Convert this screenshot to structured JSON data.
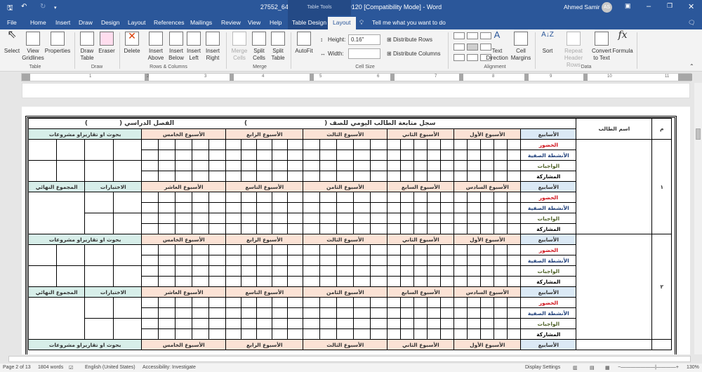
{
  "window": {
    "title": "27552_64ff1ab885a79_1694440120 [Compatibility Mode]  -  Word",
    "context_tab_group": "Table Tools",
    "user": "Ahmed Samir",
    "avatar_initials": "AS"
  },
  "tabs": [
    "File",
    "Home",
    "Insert",
    "Draw",
    "Design",
    "Layout",
    "References",
    "Mailings",
    "Review",
    "View",
    "Help",
    "Table Design",
    "Layout"
  ],
  "tell_me": "Tell me what you want to do",
  "ribbon": {
    "table": {
      "label": "Table",
      "select": "Select",
      "view_gridlines": "View Gridlines",
      "properties": "Properties"
    },
    "draw": {
      "label": "Draw",
      "draw_table": "Draw Table",
      "eraser": "Eraser"
    },
    "rows_columns": {
      "label": "Rows & Columns",
      "delete": "Delete",
      "insert_above": "Insert Above",
      "insert_below": "Insert Below",
      "insert_left": "Insert Left",
      "insert_right": "Insert Right"
    },
    "merge": {
      "label": "Merge",
      "merge_cells": "Merge Cells",
      "split_cells": "Split Cells",
      "split_table": "Split Table"
    },
    "cell_size": {
      "label": "Cell Size",
      "autofit": "AutoFit",
      "height_label": "Height:",
      "height_value": "0.16\"",
      "width_label": "Width:",
      "width_value": "",
      "distribute_rows": "Distribute Rows",
      "distribute_columns": "Distribute Columns"
    },
    "alignment": {
      "label": "Alignment",
      "text_direction": "Text Direction",
      "cell_margins": "Cell Margins"
    },
    "data": {
      "label": "Data",
      "sort": "Sort",
      "repeat_header_rows": "Repeat Header Rows",
      "convert_to_text": "Convert to Text",
      "formula": "Formula"
    }
  },
  "ruler_numbers": [
    "1",
    "2",
    "3",
    "4",
    "5",
    "6",
    "7",
    "8",
    "9",
    "10",
    "11"
  ],
  "document": {
    "title_part1": "سجل متابعة الطالب اليومي للصف (",
    "title_close1": ")",
    "title_part2": "الفصل الدراسي (",
    "title_close2": ")",
    "col_number": "م",
    "col_name": "اسم الطالب",
    "weeks_label": "الأسابيع",
    "weeks_first": [
      "الأسبوع الأول",
      "الأسبوع الثاني",
      "الأسبوع الثالث",
      "الأسبوع الرابع",
      "الأسبوع الخامس"
    ],
    "weeks_second": [
      "الأسبوع السادس",
      "الأسبوع السابع",
      "الأسبوع الثامن",
      "الأسبوع التاسع",
      "الأسبوع العاشر"
    ],
    "research": "بحوث او تقاريراو مشروعات",
    "tests": "الاختبارات",
    "final_total": "المجموع النهائي",
    "row_labels": [
      {
        "text": "الحضور",
        "color": "#d0121b"
      },
      {
        "text": "الأنشطة الصفية",
        "color": "#1f3f7a"
      },
      {
        "text": "الواجبات",
        "color": "#4f6228"
      },
      {
        "text": "المشاركة",
        "color": "#000000"
      }
    ],
    "students": [
      "١",
      "٢"
    ]
  },
  "status": {
    "page": "Page 2 of 13",
    "words": "1804 words",
    "language": "English (United States)",
    "accessibility": "Accessibility: Investigate",
    "display_settings": "Display Settings",
    "zoom": "130%"
  }
}
